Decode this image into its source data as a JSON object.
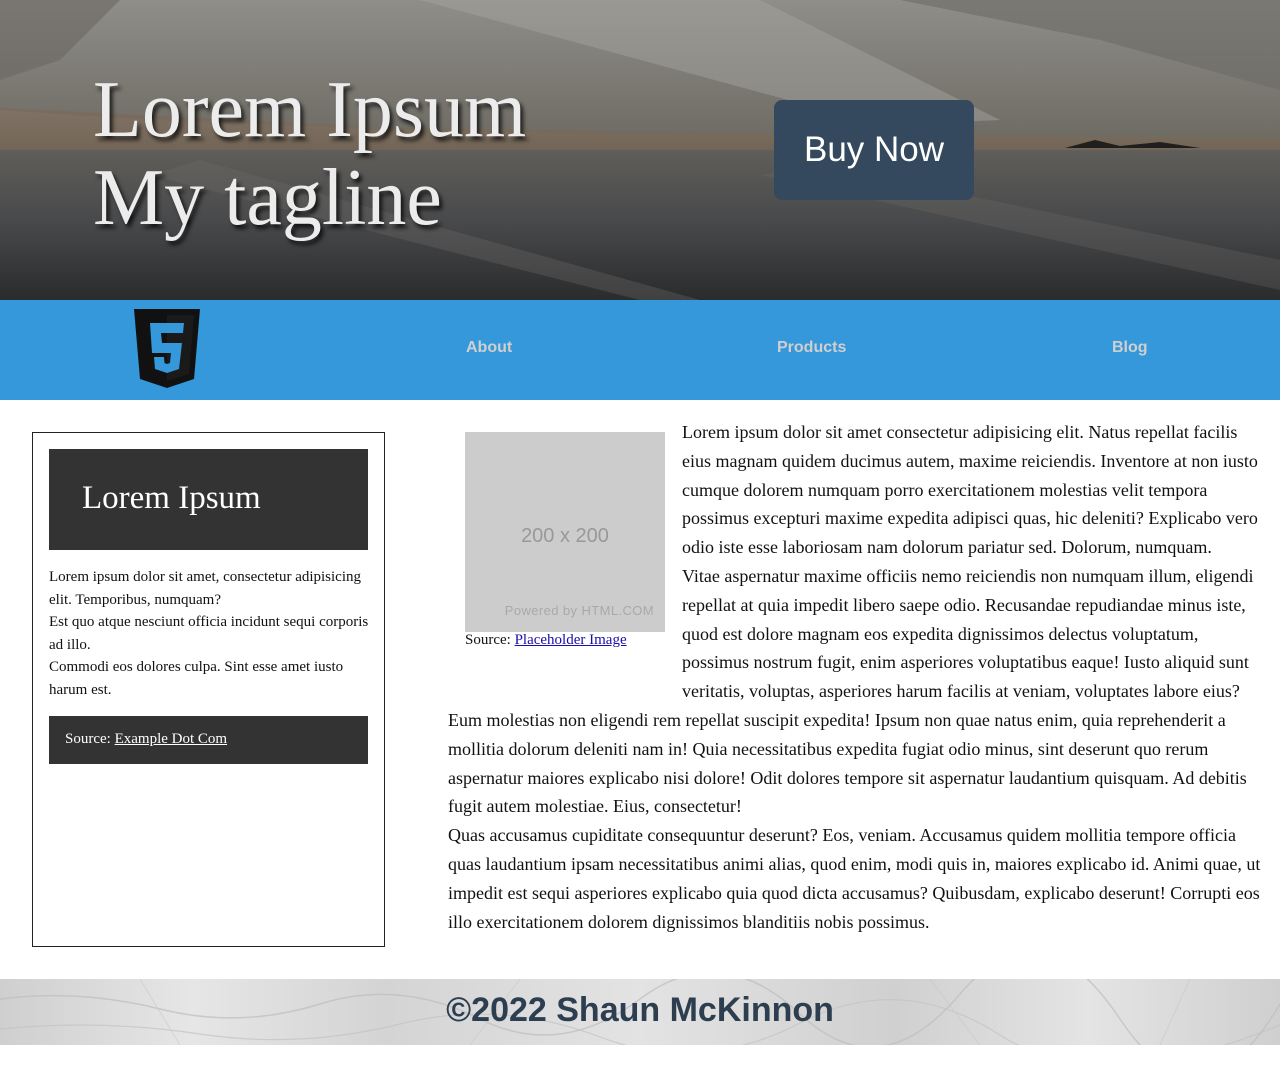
{
  "hero": {
    "title_line1": "Lorem Ipsum",
    "title_line2": "My tagline",
    "buy_label": "Buy Now"
  },
  "nav": {
    "logo_icon": "html5-logo-icon",
    "items": [
      {
        "label": "About"
      },
      {
        "label": "Products"
      },
      {
        "label": "Blog"
      }
    ]
  },
  "aside": {
    "heading": "Lorem Ipsum",
    "paragraphs": [
      "Lorem ipsum dolor sit amet, consectetur adipisicing elit. Temporibus, numquam?",
      "Est quo atque nesciunt officia incidunt sequi corporis ad illo.",
      "Commodi eos dolores culpa. Sint esse amet iusto harum est."
    ],
    "source_prefix": "Source: ",
    "source_link": "Example Dot Com"
  },
  "article": {
    "placeholder_dim": "200 x 200",
    "placeholder_powered": "Powered by HTML.COM",
    "caption_prefix": "Source: ",
    "caption_link": "Placeholder Image",
    "paragraphs": [
      "Lorem ipsum dolor sit amet consectetur adipisicing elit. Natus repellat facilis eius magnam quidem ducimus autem, maxime reiciendis. Inventore at non iusto cumque dolorem numquam porro exercitationem molestias velit tempora possimus excepturi maxime expedita adipisci quas, hic deleniti? Explicabo vero odio iste esse laboriosam nam dolorum pariatur sed. Dolorum, numquam.",
      "Vitae aspernatur maxime officiis nemo reiciendis non numquam illum, eligendi repellat at quia impedit libero saepe odio. Recusandae repudiandae minus iste, quod est dolore magnam eos expedita dignissimos delectus voluptatum, possimus nostrum fugit, enim asperiores voluptatibus eaque! Iusto aliquid sunt veritatis, voluptas, asperiores harum facilis at veniam, voluptates labore eius?",
      "Eum molestias non eligendi rem repellat suscipit expedita! Ipsum non quae natus enim, quia reprehenderit a mollitia dolorum deleniti nam in! Quia necessitatibus expedita fugiat odio minus, sint deserunt quo rerum aspernatur maiores explicabo nisi dolore! Odit dolores tempore sit aspernatur laudantium quisquam. Ad debitis fugit autem molestiae. Eius, consectetur!",
      "Quas accusamus cupiditate consequuntur deserunt? Eos, veniam. Accusamus quidem mollitia tempore officia quas laudantium ipsam necessitatibus animi alias, quod enim, modi quis in, maiores explicabo id. Animi quae, ut impedit est sequi asperiores explicabo quia quod dicta accusamus? Quibusdam, explicabo deserunt! Corrupti eos illo exercitationem dolorem dignissimos blanditiis nobis possimus."
    ]
  },
  "footer": {
    "copyright": "©2022 Shaun McKinnon"
  },
  "colors": {
    "nav_bg": "#3498db",
    "button_bg": "#34495e",
    "aside_dark": "#333333",
    "footer_text": "#2c3e50"
  }
}
